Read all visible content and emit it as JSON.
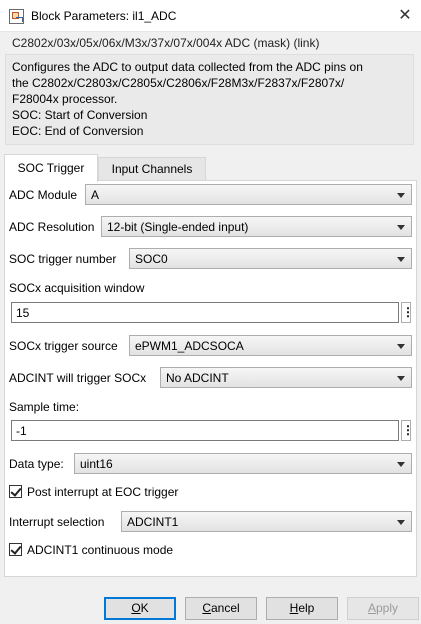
{
  "window": {
    "title": "Block Parameters: il1_ADC",
    "icon": "simulink-block-icon",
    "close": "✕"
  },
  "mask_header": "C2802x/03x/05x/06x/M3x/37x/07x/004x ADC (mask) (link)",
  "description": [
    "Configures the ADC to output data collected from the ADC pins on",
    "the C2802x/C2803x/C2805x/C2806x/F28M3x/F2837x/F2807x/",
    "F28004x processor.",
    "SOC: Start of Conversion",
    "EOC: End of Conversion"
  ],
  "tabs": [
    "SOC Trigger",
    "Input Channels"
  ],
  "params": {
    "adc_module": {
      "label": "ADC Module",
      "value": "A"
    },
    "adc_resolution": {
      "label": "ADC Resolution",
      "value": "12-bit (Single-ended input)"
    },
    "soc_trigger_number": {
      "label": "SOC trigger number",
      "value": "SOC0"
    },
    "socx_acq_window": {
      "label": "SOCx acquisition window",
      "value": "15"
    },
    "socx_trigger_source": {
      "label": "SOCx trigger source",
      "value": "ePWM1_ADCSOCA"
    },
    "adcint_trigger_socx": {
      "label": "ADCINT will trigger SOCx",
      "value": "No ADCINT"
    },
    "sample_time": {
      "label": "Sample time:",
      "value": "-1"
    },
    "data_type": {
      "label": "Data type:",
      "value": "uint16"
    },
    "post_interrupt": {
      "label": "Post interrupt at EOC trigger",
      "checked": true
    },
    "interrupt_selection": {
      "label": "Interrupt selection",
      "value": "ADCINT1"
    },
    "adcint1_continuous": {
      "label": "ADCINT1 continuous mode",
      "checked": true
    },
    "dots": "⋮"
  },
  "buttons": {
    "ok": {
      "mnemonic": "O",
      "rest": "K"
    },
    "cancel": {
      "mnemonic": "C",
      "rest": "ancel"
    },
    "help": {
      "mnemonic": "H",
      "rest": "elp"
    },
    "apply": {
      "mnemonic": "A",
      "rest": "pply"
    }
  }
}
